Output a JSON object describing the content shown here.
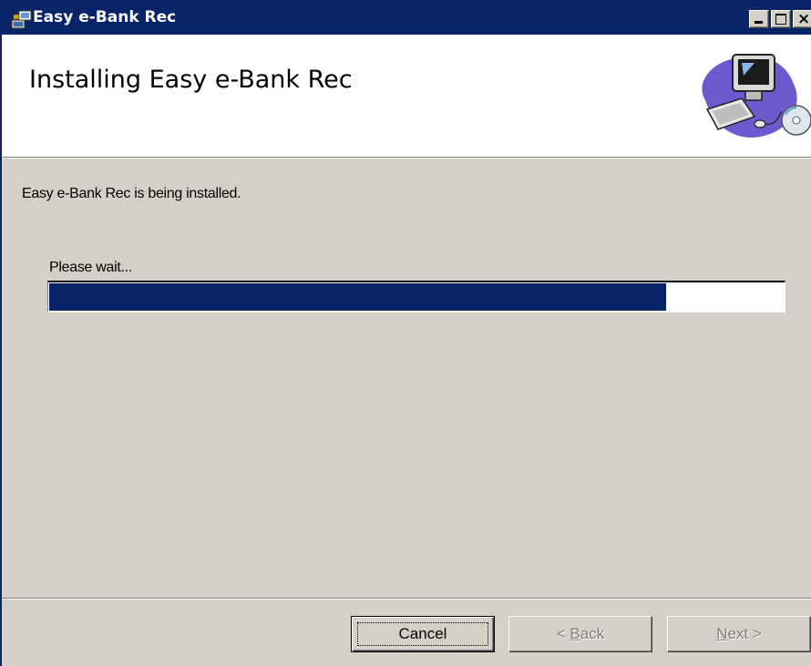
{
  "window": {
    "title": "Easy e-Bank Rec",
    "title_icon": "installer-icon",
    "controls": {
      "minimize": "minimize-icon",
      "maximize": "maximize-icon",
      "close": "×"
    }
  },
  "banner": {
    "heading": "Installing Easy e-Bank Rec",
    "art": "computer-setup-icon"
  },
  "body": {
    "status": "Easy e-Bank Rec is being installed.",
    "wait_label": "Please wait...",
    "progress": {
      "percent": 84
    }
  },
  "footer": {
    "cancel": "Cancel",
    "back": {
      "prefix": "< ",
      "accel": "B",
      "rest": "ack"
    },
    "next": {
      "accel": "N",
      "rest": "ext",
      "suffix": " >"
    }
  },
  "colors": {
    "titlebar": "#0a246a",
    "face": "#d4d0c8",
    "progress_fill": "#0a246a"
  }
}
